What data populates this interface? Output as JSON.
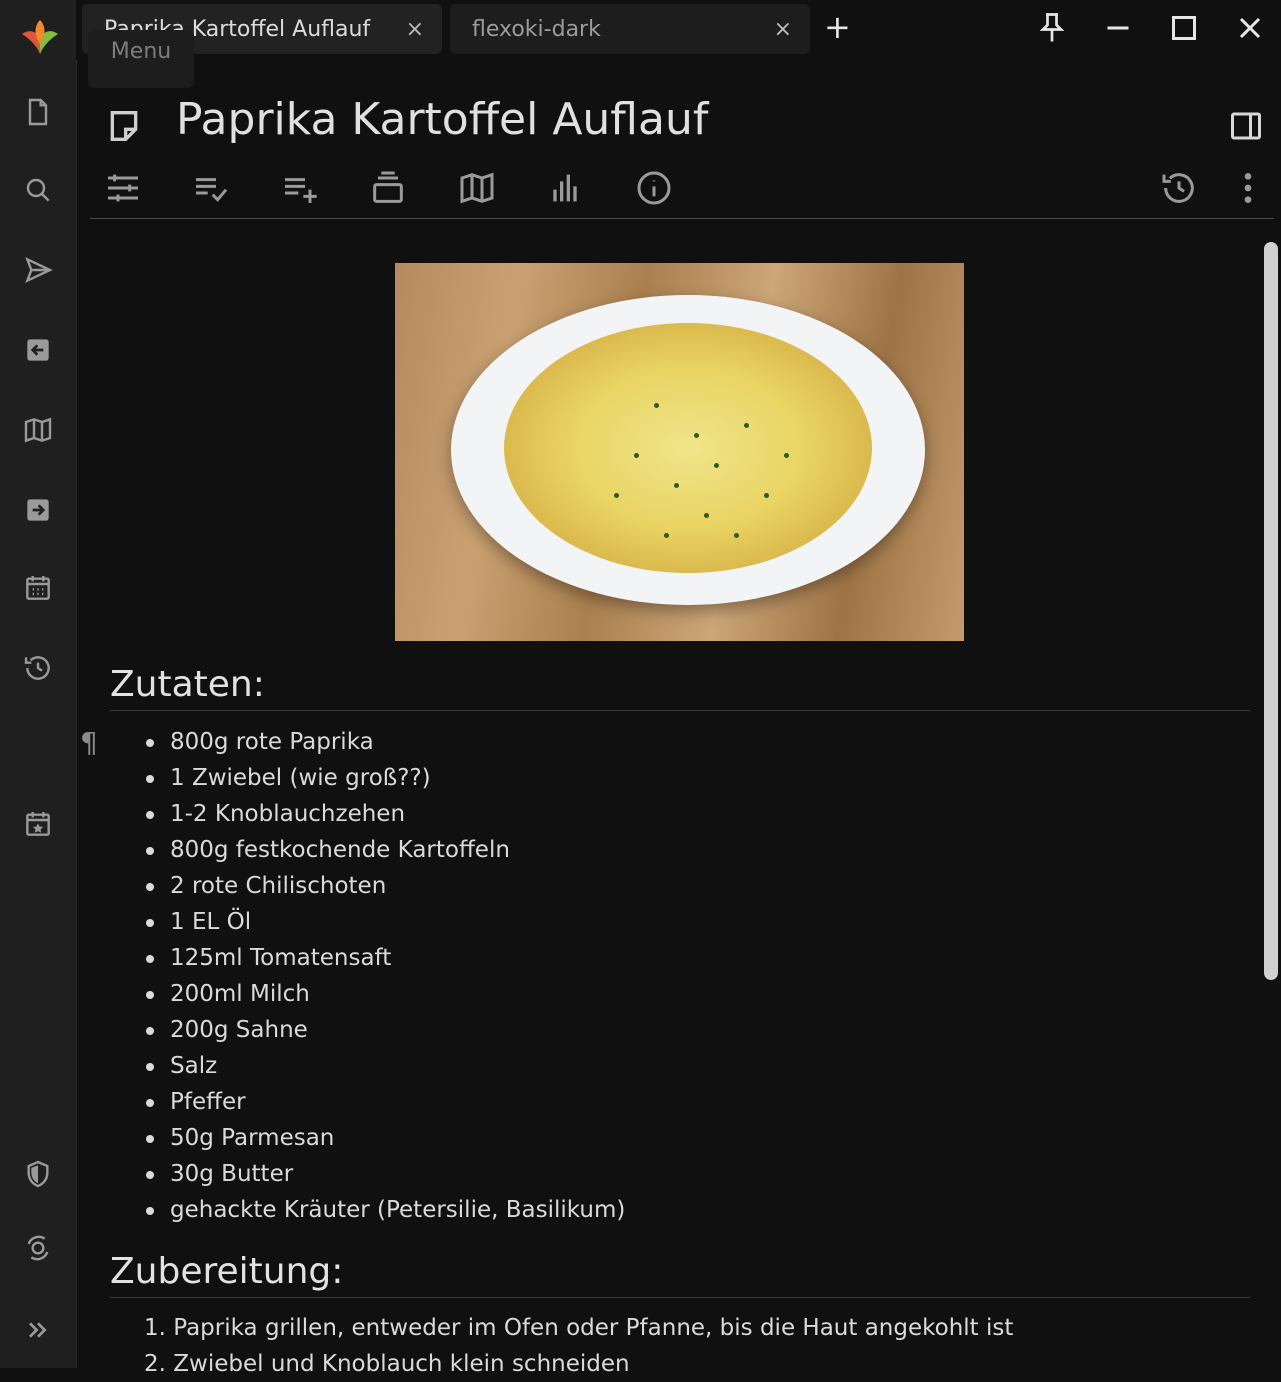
{
  "tabs": [
    {
      "label": "Paprika Kartoffel Auflauf",
      "active": true
    },
    {
      "label": "flexoki-dark",
      "active": false
    }
  ],
  "tab_close_glyph": "×",
  "new_tab_glyph": "+",
  "menu_tooltip": "Menu",
  "note": {
    "title": "Paprika Kartoffel Auflauf"
  },
  "sections": {
    "ingredients_heading": "Zutaten:",
    "preparation_heading": "Zubereitung:"
  },
  "pilcrow": "¶",
  "ingredients": [
    "800g rote Paprika",
    "1 Zwiebel (wie groß??)",
    "1-2 Knoblauchzehen",
    "800g festkochende Kartoffeln",
    "2 rote Chilischoten",
    "1 EL Öl",
    "125ml Tomatensaft",
    "200ml Milch",
    "200g Sahne",
    "Salz",
    "Pfeffer",
    "50g Parmesan",
    "30g Butter",
    "gehackte Kräuter (Petersilie, Basilikum)"
  ],
  "steps": [
    "1. Paprika grillen, entweder im Ofen oder Pfanne, bis die Haut angekohlt ist",
    "2. Zwiebel und Knoblauch klein schneiden"
  ],
  "icons": {
    "sidebar": [
      "new-note-icon",
      "search-icon",
      "jump-to-note-icon",
      "back-in-history-icon",
      "note-map-icon",
      "forward-in-history-icon",
      "calendar-icon",
      "recent-changes-icon",
      "launch-bar-calendar-icon",
      "protected-session-icon",
      "sync-status-icon",
      "expand-sidebar-icon"
    ],
    "toolbar": [
      "basic-properties-icon",
      "promoted-attributes-icon",
      "owned-attributes-icon",
      "inherited-attributes-icon",
      "note-map-icon",
      "similar-notes-icon",
      "note-info-icon",
      "note-revisions-icon",
      "more-options-icon"
    ]
  },
  "colors": {
    "background": "#101010",
    "sidebar": "#1f1f1f",
    "text": "#dadada"
  }
}
